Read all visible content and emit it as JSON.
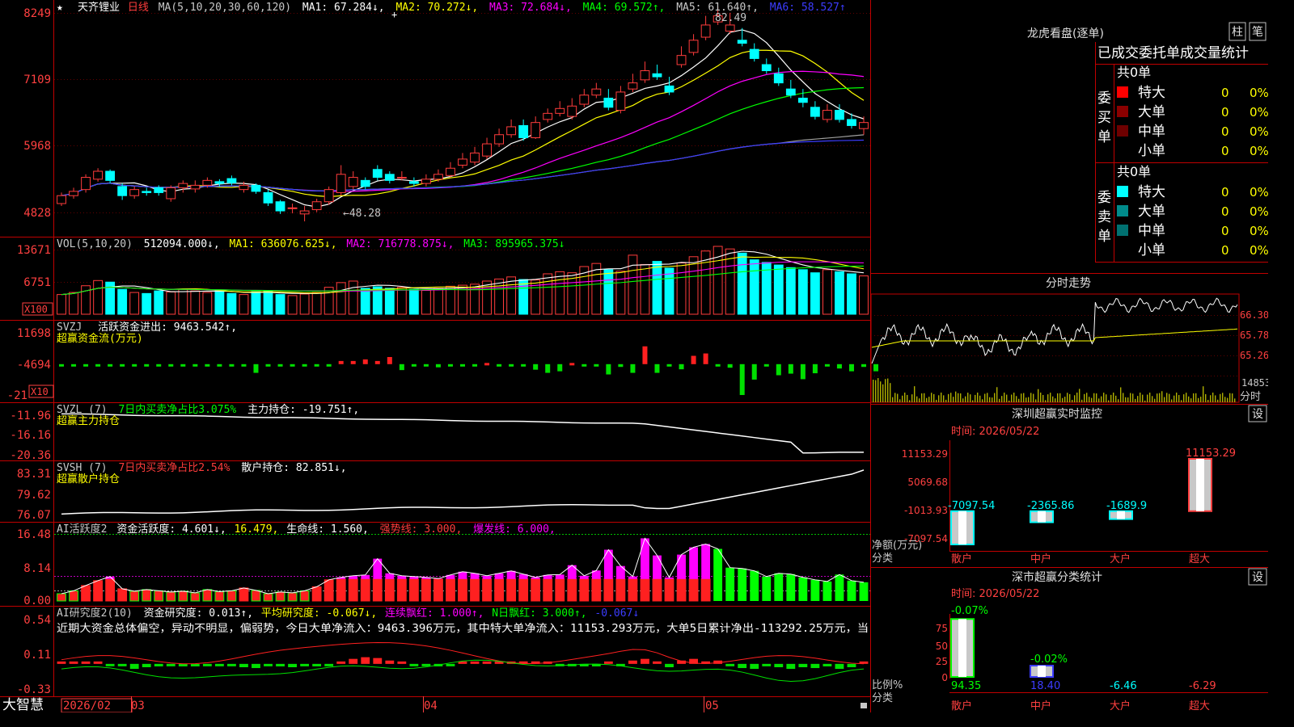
{
  "stock": {
    "name": "天齐锂业",
    "period": "日线",
    "star": "★",
    "brand": "大智慧",
    "dates": {
      "start": "2026/02",
      "m3": "03",
      "m4": "04",
      "m5": "05"
    }
  },
  "colors": {
    "up": "#ff3c3c",
    "down": "#00ffff",
    "ma1": "#ffffff",
    "ma2": "#ffff00",
    "ma3": "#ff00ff",
    "ma4": "#00ff00",
    "ma5": "#a0a0a0",
    "ma6": "#3c3cff",
    "grid": "#c00000"
  },
  "price_panel": {
    "legend": {
      "ma_def": "MA(5,10,20,30,60,120)",
      "ma1": "MA1: 67.284↓,",
      "ma2": "MA2: 70.272↓,",
      "ma3": "MA3: 72.684↓,",
      "ma4": "MA4: 69.572↑,",
      "ma5": "MA5: 61.640↑,",
      "ma6": "MA6: 58.527↑"
    },
    "yticks": [
      "8249",
      "7109",
      "5968",
      "4828"
    ],
    "high_label": "82.49",
    "low_label": "←48.28"
  },
  "vol_panel": {
    "legend": {
      "def": "VOL(5,10,20)",
      "vol": "512094.000↓,",
      "ma1": "MA1: 636076.625↓,",
      "ma2": "MA2: 716778.875↓,",
      "ma3": "MA3: 895965.375↓"
    },
    "yticks": [
      "13671",
      "6751"
    ],
    "unit": "X100"
  },
  "svzj_panel": {
    "legend": {
      "def": "SVZJ",
      "label": "活跃资金进出: 9463.542↑,",
      "sub": "超赢资金流(万元)"
    },
    "yticks": [
      "11698",
      "-4694",
      "-21"
    ],
    "unit": "X10"
  },
  "svzl_panel": {
    "legend": {
      "def": "SVZL (7)",
      "ratio": "7日内买卖净占比3.075%",
      "label": "主力持仓: -19.751↑,",
      "sub": "超赢主力持仓"
    },
    "yticks": [
      "-11.96",
      "-16.16",
      "-20.36"
    ]
  },
  "svsh_panel": {
    "legend": {
      "def": "SVSH (7)",
      "ratio": "7日内买卖净占比2.54%",
      "label": "散户持仓: 82.851↓,",
      "sub": "超赢散户持仓"
    },
    "yticks": [
      "83.31",
      "79.62",
      "76.07"
    ]
  },
  "ai_active_panel": {
    "legend": {
      "def": "AI活跃度2",
      "a": "资金活跃度: 4.601↓,",
      "b": "16.479,",
      "c": "生命线: 1.560,",
      "d": "强势线: 3.000,",
      "e": "爆发线: 6.000,"
    },
    "yticks": [
      "16.48",
      "8.14",
      "0.00"
    ]
  },
  "ai_research_panel": {
    "legend": {
      "def": "AI研究度2(10)",
      "a": "资金研究度: 0.013↑,",
      "b": "平均研究度: -0.067↓,",
      "c": "连续飘红: 1.000↑,",
      "d": "N日飘红: 3.000↑,",
      "e": "-0.067↓"
    },
    "comment": "近期大资金总体偏空，异动不明显，偏弱势，今日大单净流入：9463.396万元，其中特大单净流入：11153.293万元，大单5日累计净出-113292.25万元，当",
    "yticks": [
      "0.54",
      "0.11",
      "-0.33"
    ]
  },
  "right_panel": {
    "dragon_title": "龙虎看盘(逐单)",
    "btn_zhu": "柱",
    "btn_bi": "笔",
    "order_title": "已成交委托单成交量统计",
    "buy": {
      "side_label": "委买单",
      "total": "共0单",
      "rows": [
        {
          "label": "特大",
          "count": "0",
          "pct": "0%",
          "color": "#ff0000"
        },
        {
          "label": "大单",
          "count": "0",
          "pct": "0%",
          "color": "#8b0000"
        },
        {
          "label": "中单",
          "count": "0",
          "pct": "0%",
          "color": "#6e0000"
        },
        {
          "label": "小单",
          "count": "0",
          "pct": "0%",
          "color": "#000000"
        }
      ]
    },
    "sell": {
      "side_label": "委卖单",
      "total": "共0单",
      "rows": [
        {
          "label": "特大",
          "count": "0",
          "pct": "0%",
          "color": "#00ffff"
        },
        {
          "label": "大单",
          "count": "0",
          "pct": "0%",
          "color": "#008b8b"
        },
        {
          "label": "中单",
          "count": "0",
          "pct": "0%",
          "color": "#007070"
        },
        {
          "label": "小单",
          "count": "0",
          "pct": "0%",
          "color": "#000000"
        }
      ]
    },
    "intraday": {
      "title": "分时走势",
      "yticks": [
        "66.30",
        "65.78",
        "65.26",
        "14853"
      ],
      "unit": "分时"
    },
    "monitor": {
      "title": "深圳超赢实时监控",
      "btn": "设",
      "time": "时间: 2026/05/22",
      "yticks": [
        "11153.29",
        "5069.68",
        "-1013.93",
        "-7097.54"
      ],
      "ylabel": "净额(万元)",
      "xlabel": "分类",
      "categories": [
        "散户",
        "中户",
        "大户",
        "超大"
      ],
      "values": [
        -7097.54,
        -2365.86,
        -1689.9,
        11153.29
      ],
      "value_labels": [
        "-7097.54",
        "-2365.86",
        "-1689.9",
        "11153.29"
      ]
    },
    "classify": {
      "title": "深市超赢分类统计",
      "btn": "设",
      "time": "时间: 2026/05/22",
      "yticks": [
        "75",
        "50",
        "25",
        "0"
      ],
      "ylabel": "比例%",
      "xlabel": "分类",
      "categories": [
        "散户",
        "中户",
        "大户",
        "超大"
      ],
      "values": [
        94.35,
        18.4,
        -6.46,
        -6.29
      ],
      "value_labels": [
        "94.35",
        "18.40",
        "-6.46",
        "-6.29"
      ],
      "top_labels": [
        "-0.07%",
        "-0.02%"
      ]
    }
  },
  "chart_data": {
    "type": "candlestick",
    "title": "天齐锂业 日线",
    "price": {
      "ylim": [
        45.9,
        84.6
      ],
      "open": [
        51.2,
        52.5,
        53.5,
        55.2,
        56.5,
        54.0,
        52.5,
        53.2,
        53.8,
        52.0,
        53.8,
        53.6,
        54.2,
        54.8,
        55.3,
        53.5,
        54.2,
        53.0,
        51.5,
        50.5,
        49.5,
        50.2,
        51.5,
        53.0,
        54.0,
        55.0,
        56.8,
        56.0,
        55.5,
        54.8,
        54.5,
        55.2,
        55.8,
        57.5,
        58.0,
        59.0,
        61.0,
        62.5,
        64.0,
        62.0,
        65.0,
        66.0,
        65.5,
        67.5,
        69.0,
        68.5,
        66.5,
        70.0,
        71.5,
        72.5,
        70.5,
        74.0,
        76.0,
        78.5,
        81.0,
        79.5,
        78.0,
        76.5,
        74.0,
        72.5,
        70.0,
        68.5,
        67.0,
        65.0,
        66.5,
        65.0,
        63.5
      ],
      "close": [
        52.5,
        53.2,
        55.5,
        56.5,
        55.0,
        52.5,
        53.5,
        53.0,
        53.0,
        53.8,
        54.5,
        54.2,
        55.0,
        54.5,
        54.6,
        54.2,
        53.2,
        51.3,
        50.0,
        50.5,
        50.0,
        51.5,
        53.5,
        56.0,
        55.5,
        54.0,
        55.5,
        55.0,
        55.5,
        54.5,
        55.2,
        56.0,
        57.0,
        58.5,
        59.5,
        61.0,
        62.5,
        63.8,
        62.0,
        64.5,
        66.0,
        66.8,
        67.2,
        69.0,
        70.0,
        67.0,
        69.5,
        71.0,
        73.0,
        72.0,
        69.5,
        75.5,
        78.0,
        80.5,
        82.0,
        80.5,
        77.5,
        75.0,
        73.0,
        71.0,
        69.0,
        67.8,
        65.5,
        66.5,
        65.0,
        64.0,
        64.5
      ],
      "high": [
        53.0,
        53.8,
        56.0,
        57.0,
        56.8,
        54.5,
        54.0,
        53.8,
        54.2,
        54.2,
        55.0,
        55.0,
        55.5,
        55.2,
        55.8,
        54.8,
        54.5,
        53.5,
        51.8,
        51.2,
        50.8,
        52.0,
        54.0,
        57.5,
        56.5,
        55.5,
        57.5,
        56.5,
        56.5,
        55.5,
        56.0,
        56.8,
        58.0,
        59.5,
        60.5,
        62.0,
        63.5,
        65.0,
        65.0,
        65.5,
        66.8,
        68.0,
        68.5,
        70.0,
        71.0,
        70.0,
        70.5,
        72.5,
        74.5,
        74.0,
        72.0,
        77.0,
        79.0,
        82.0,
        83.5,
        82.5,
        80.0,
        77.5,
        75.0,
        73.5,
        71.5,
        70.0,
        68.0,
        67.5,
        67.5,
        66.0,
        65.5
      ],
      "low": [
        50.8,
        52.0,
        53.0,
        54.8,
        54.5,
        51.8,
        52.0,
        52.5,
        52.5,
        51.5,
        53.0,
        53.0,
        53.8,
        54.0,
        54.2,
        53.0,
        52.8,
        50.8,
        49.5,
        49.6,
        48.28,
        49.8,
        51.0,
        52.5,
        53.5,
        53.5,
        55.0,
        54.5,
        55.0,
        54.0,
        54.0,
        54.8,
        55.5,
        57.0,
        57.5,
        58.5,
        60.5,
        62.0,
        61.5,
        61.8,
        64.5,
        65.5,
        65.0,
        67.0,
        68.5,
        66.5,
        66.0,
        69.5,
        71.0,
        71.5,
        69.0,
        73.5,
        75.5,
        78.0,
        80.5,
        79.0,
        77.0,
        74.5,
        72.5,
        70.5,
        68.5,
        67.0,
        65.0,
        64.5,
        64.5,
        63.5,
        62.5
      ],
      "ma_series": [
        {
          "name": "MA1",
          "last": 67.284
        },
        {
          "name": "MA2",
          "last": 70.272
        },
        {
          "name": "MA3",
          "last": 72.684
        },
        {
          "name": "MA4",
          "last": 69.572
        },
        {
          "name": "MA5",
          "last": 61.64
        },
        {
          "name": "MA6",
          "last": 58.527
        }
      ],
      "high_mark": 82.49,
      "low_mark": 48.28
    },
    "volume": {
      "ylim": [
        0,
        14500
      ],
      "values": [
        3800,
        4200,
        5500,
        6500,
        6200,
        4800,
        4200,
        4000,
        4500,
        4300,
        4800,
        4500,
        4200,
        4600,
        4000,
        3800,
        4400,
        4500,
        3800,
        3600,
        3900,
        4200,
        5200,
        6100,
        6400,
        5000,
        5300,
        5000,
        5200,
        4800,
        4600,
        5000,
        5400,
        5600,
        5800,
        6400,
        6800,
        7200,
        6700,
        6600,
        7800,
        8200,
        8000,
        9200,
        9800,
        8600,
        8300,
        11400,
        9600,
        10200,
        8900,
        9900,
        11100,
        12200,
        13100,
        12600,
        11800,
        10500,
        10000,
        9500,
        9000,
        8600,
        8000,
        8600,
        8200,
        7800,
        7400
      ]
    },
    "svzj": {
      "ylim": [
        -8000,
        12000
      ],
      "values": [
        -300,
        -300,
        -250,
        -300,
        -250,
        -300,
        -350,
        -400,
        -300,
        -300,
        -350,
        -300,
        -280,
        -250,
        -300,
        -600,
        -2200,
        -300,
        -300,
        -300,
        -300,
        -250,
        -300,
        800,
        800,
        1200,
        800,
        1800,
        -1500,
        -400,
        -600,
        -800,
        -300,
        -300,
        -300,
        300,
        -300,
        -400,
        -300,
        -1400,
        -2200,
        -1800,
        300,
        -500,
        -300,
        -2600,
        -700,
        -2200,
        4500,
        -2200,
        -300,
        -1300,
        2100,
        2700,
        -300,
        -900,
        -7800,
        -3900,
        -300,
        -2800,
        -2400,
        -3800,
        -2300,
        -600,
        -1100,
        -1800,
        -700,
        -1800
      ],
      "last": 9463.542
    },
    "svzl": {
      "ylim": [
        -21.0,
        -11.5
      ],
      "last": -19.751
    },
    "svsh": {
      "ylim": [
        75.5,
        84.0
      ],
      "last": 82.851
    },
    "ai_active": {
      "ylim": [
        0,
        16.48
      ],
      "values": [
        1.8,
        2.5,
        3.8,
        5.0,
        6.0,
        3.0,
        2.4,
        2.8,
        2.5,
        2.2,
        2.4,
        2.0,
        2.8,
        2.3,
        2.5,
        3.2,
        2.6,
        1.8,
        2.2,
        2.0,
        2.5,
        3.5,
        5.2,
        5.8,
        6.2,
        6.4,
        10.4,
        6.8,
        6.2,
        6.0,
        5.8,
        5.5,
        6.4,
        7.2,
        6.8,
        6.2,
        6.8,
        7.4,
        6.6,
        5.8,
        6.4,
        6.5,
        8.8,
        6.2,
        7.5,
        12.6,
        8.6,
        6.0,
        15.4,
        11.2,
        5.8,
        11.4,
        13.2,
        14.0,
        12.8,
        8.2,
        8.0,
        7.4,
        6.0,
        6.8,
        6.6,
        5.8,
        5.2,
        4.8,
        6.5,
        5.0,
        4.6
      ],
      "lines": {
        "strong": 3.0,
        "burst": 6.0,
        "life": 1.56
      }
    },
    "ai_research": {
      "ylim": [
        -0.33,
        0.54
      ],
      "values": [
        0.01,
        0.01,
        0.0,
        0.01,
        -0.01,
        -0.02,
        -0.06,
        -0.04,
        -0.03,
        -0.02,
        -0.03,
        -0.03,
        -0.02,
        -0.02,
        -0.01,
        -0.04,
        -0.05,
        -0.02,
        -0.03,
        -0.04,
        -0.02,
        -0.03,
        -0.02,
        0.02,
        0.06,
        0.08,
        0.07,
        0.04,
        0.02,
        -0.01,
        -0.02,
        -0.03,
        -0.02,
        0.01,
        0.01,
        0.02,
        0.03,
        0.02,
        0.03,
        0.03,
        0.01,
        -0.02,
        -0.02,
        -0.03,
        -0.03,
        0.02,
        -0.02,
        0.04,
        0.06,
        0.03,
        -0.04,
        0.04,
        0.06,
        0.03,
        0.04,
        -0.02,
        -0.05,
        -0.06,
        -0.02,
        -0.04,
        -0.06,
        -0.04,
        -0.05,
        -0.03,
        -0.06,
        -0.04,
        0.013
      ],
      "avg_last": -0.067
    }
  }
}
